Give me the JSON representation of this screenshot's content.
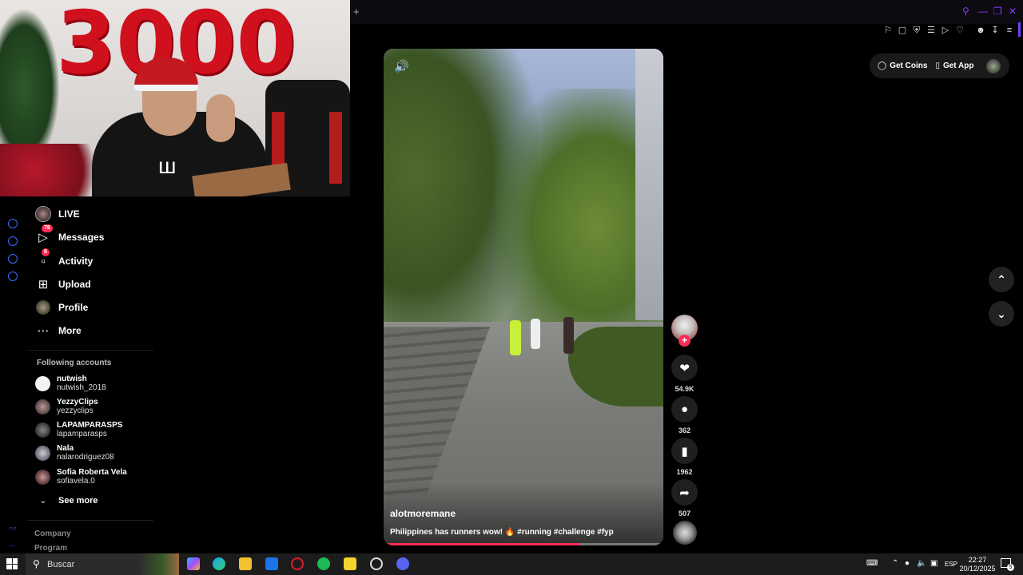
{
  "browser": {
    "new_tab": "+",
    "toolbar_icons": [
      "pin-icon",
      "screenshot-icon",
      "shield-icon",
      "translate-icon",
      "play-icon",
      "heart-icon",
      "account-icon",
      "download-icon",
      "menu-icon"
    ],
    "window_controls": [
      "search-icon",
      "minimize-icon",
      "restore-icon",
      "close-icon"
    ]
  },
  "webcam": {
    "balloon_text": "3000"
  },
  "nav": {
    "items": [
      {
        "label": "LIVE"
      },
      {
        "label": "Messages",
        "badge": "78"
      },
      {
        "label": "Activity",
        "badge": "6"
      },
      {
        "label": "Upload"
      },
      {
        "label": "Profile"
      },
      {
        "label": "More"
      }
    ]
  },
  "following": {
    "title": "Following accounts",
    "accounts": [
      {
        "name": "nutwish",
        "handle": "nutwish_2018"
      },
      {
        "name": "YezzyClips",
        "handle": "yezzyclips"
      },
      {
        "name": "LAPAMPARASPS",
        "handle": "lapamparasps"
      },
      {
        "name": "Nala",
        "handle": "nalarodriguez08"
      },
      {
        "name": "Sofia Roberta Vela",
        "handle": "sofiavela.0"
      }
    ],
    "see_more": "See more"
  },
  "footer": {
    "links": [
      "Company",
      "Program"
    ]
  },
  "video": {
    "author": "alotmoremane",
    "caption": "Philippines has runners wow! 🔥 #running #challenge #fyp",
    "progress": 0.7
  },
  "actions": {
    "likes": "54.9K",
    "comments": "362",
    "saves": "1962",
    "shares": "507"
  },
  "header_right": {
    "get_coins": "Get Coins",
    "get_app": "Get App"
  },
  "taskbar": {
    "search_placeholder": "Buscar",
    "language": "ESP",
    "time": "22:27",
    "date": "20/12/2025",
    "notification_count": "5"
  },
  "colors": {
    "accent": "#fe2c55",
    "browser_accent": "#8a3cff",
    "rail_icon": "#3a6cff"
  }
}
